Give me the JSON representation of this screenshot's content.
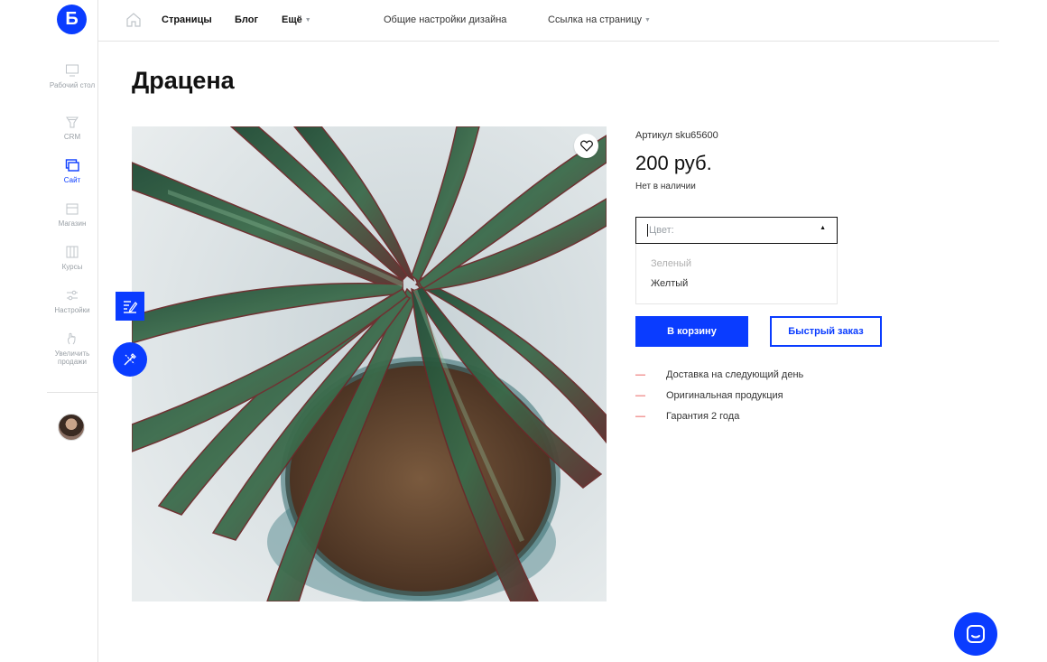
{
  "brand": {
    "logo_letter": "Б",
    "accent": "#0a3cff"
  },
  "sidebar": {
    "items": [
      {
        "label": "Рабочий стол",
        "icon": "monitor-icon",
        "active": false
      },
      {
        "label": "CRM",
        "icon": "funnel-icon",
        "active": false
      },
      {
        "label": "Сайт",
        "icon": "site-icon",
        "active": true
      },
      {
        "label": "Магазин",
        "icon": "store-icon",
        "active": false
      },
      {
        "label": "Курсы",
        "icon": "courses-icon",
        "active": false
      },
      {
        "label": "Настройки",
        "icon": "sliders-icon",
        "active": false
      },
      {
        "label": "Увеличить продажи",
        "icon": "hand-icon",
        "active": false
      }
    ]
  },
  "topbar": {
    "nav": [
      {
        "label": "Страницы"
      },
      {
        "label": "Блог"
      },
      {
        "label": "Ещё"
      }
    ],
    "design_settings": "Общие настройки дизайна",
    "page_link": "Ссылка на страницу"
  },
  "product": {
    "title": "Драцена",
    "sku": "Артикул sku65600",
    "price": "200 руб.",
    "stock": "Нет в наличии",
    "color_select": {
      "placeholder": "Цвет:",
      "options": [
        {
          "label": "Зеленый",
          "disabled": true
        },
        {
          "label": "Желтый",
          "disabled": false
        }
      ]
    },
    "add_to_cart": "В корзину",
    "quick_order": "Быстрый заказ",
    "features": [
      "Доставка на следующий день",
      "Оригинальная продукция",
      "Гарантия 2 года"
    ]
  },
  "colors": {
    "accent": "#0a3cff",
    "dash": "#e53935",
    "muted": "#9aa0a6"
  }
}
